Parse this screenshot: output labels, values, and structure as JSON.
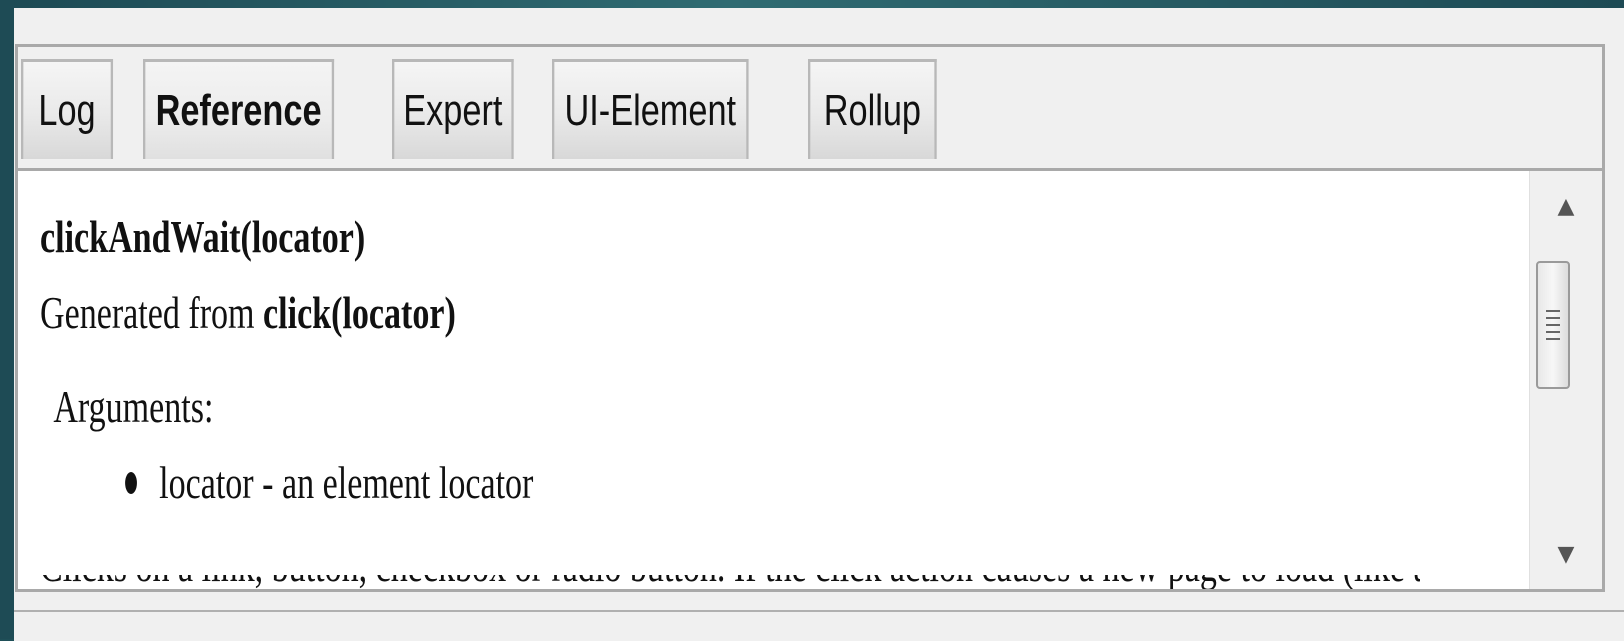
{
  "tabs": [
    {
      "label": "Log",
      "active": false
    },
    {
      "label": "Reference",
      "active": true
    },
    {
      "label": "Expert",
      "active": false
    },
    {
      "label": "UI-Element",
      "active": false
    },
    {
      "label": "Rollup",
      "active": false
    }
  ],
  "reference": {
    "command": "clickAndWait(locator)",
    "generated_prefix": "Generated from ",
    "generated_command": "click(locator)",
    "arguments_label": "Arguments:",
    "arguments": [
      "locator - an element locator"
    ],
    "cut_off_text": "Clicks on a link, button, checkbox or radio button. If the click action causes a new page to load (like a link"
  },
  "scrollbar": {
    "up_icon": "scroll-up-arrow-icon",
    "down_icon": "scroll-down-arrow-icon"
  }
}
